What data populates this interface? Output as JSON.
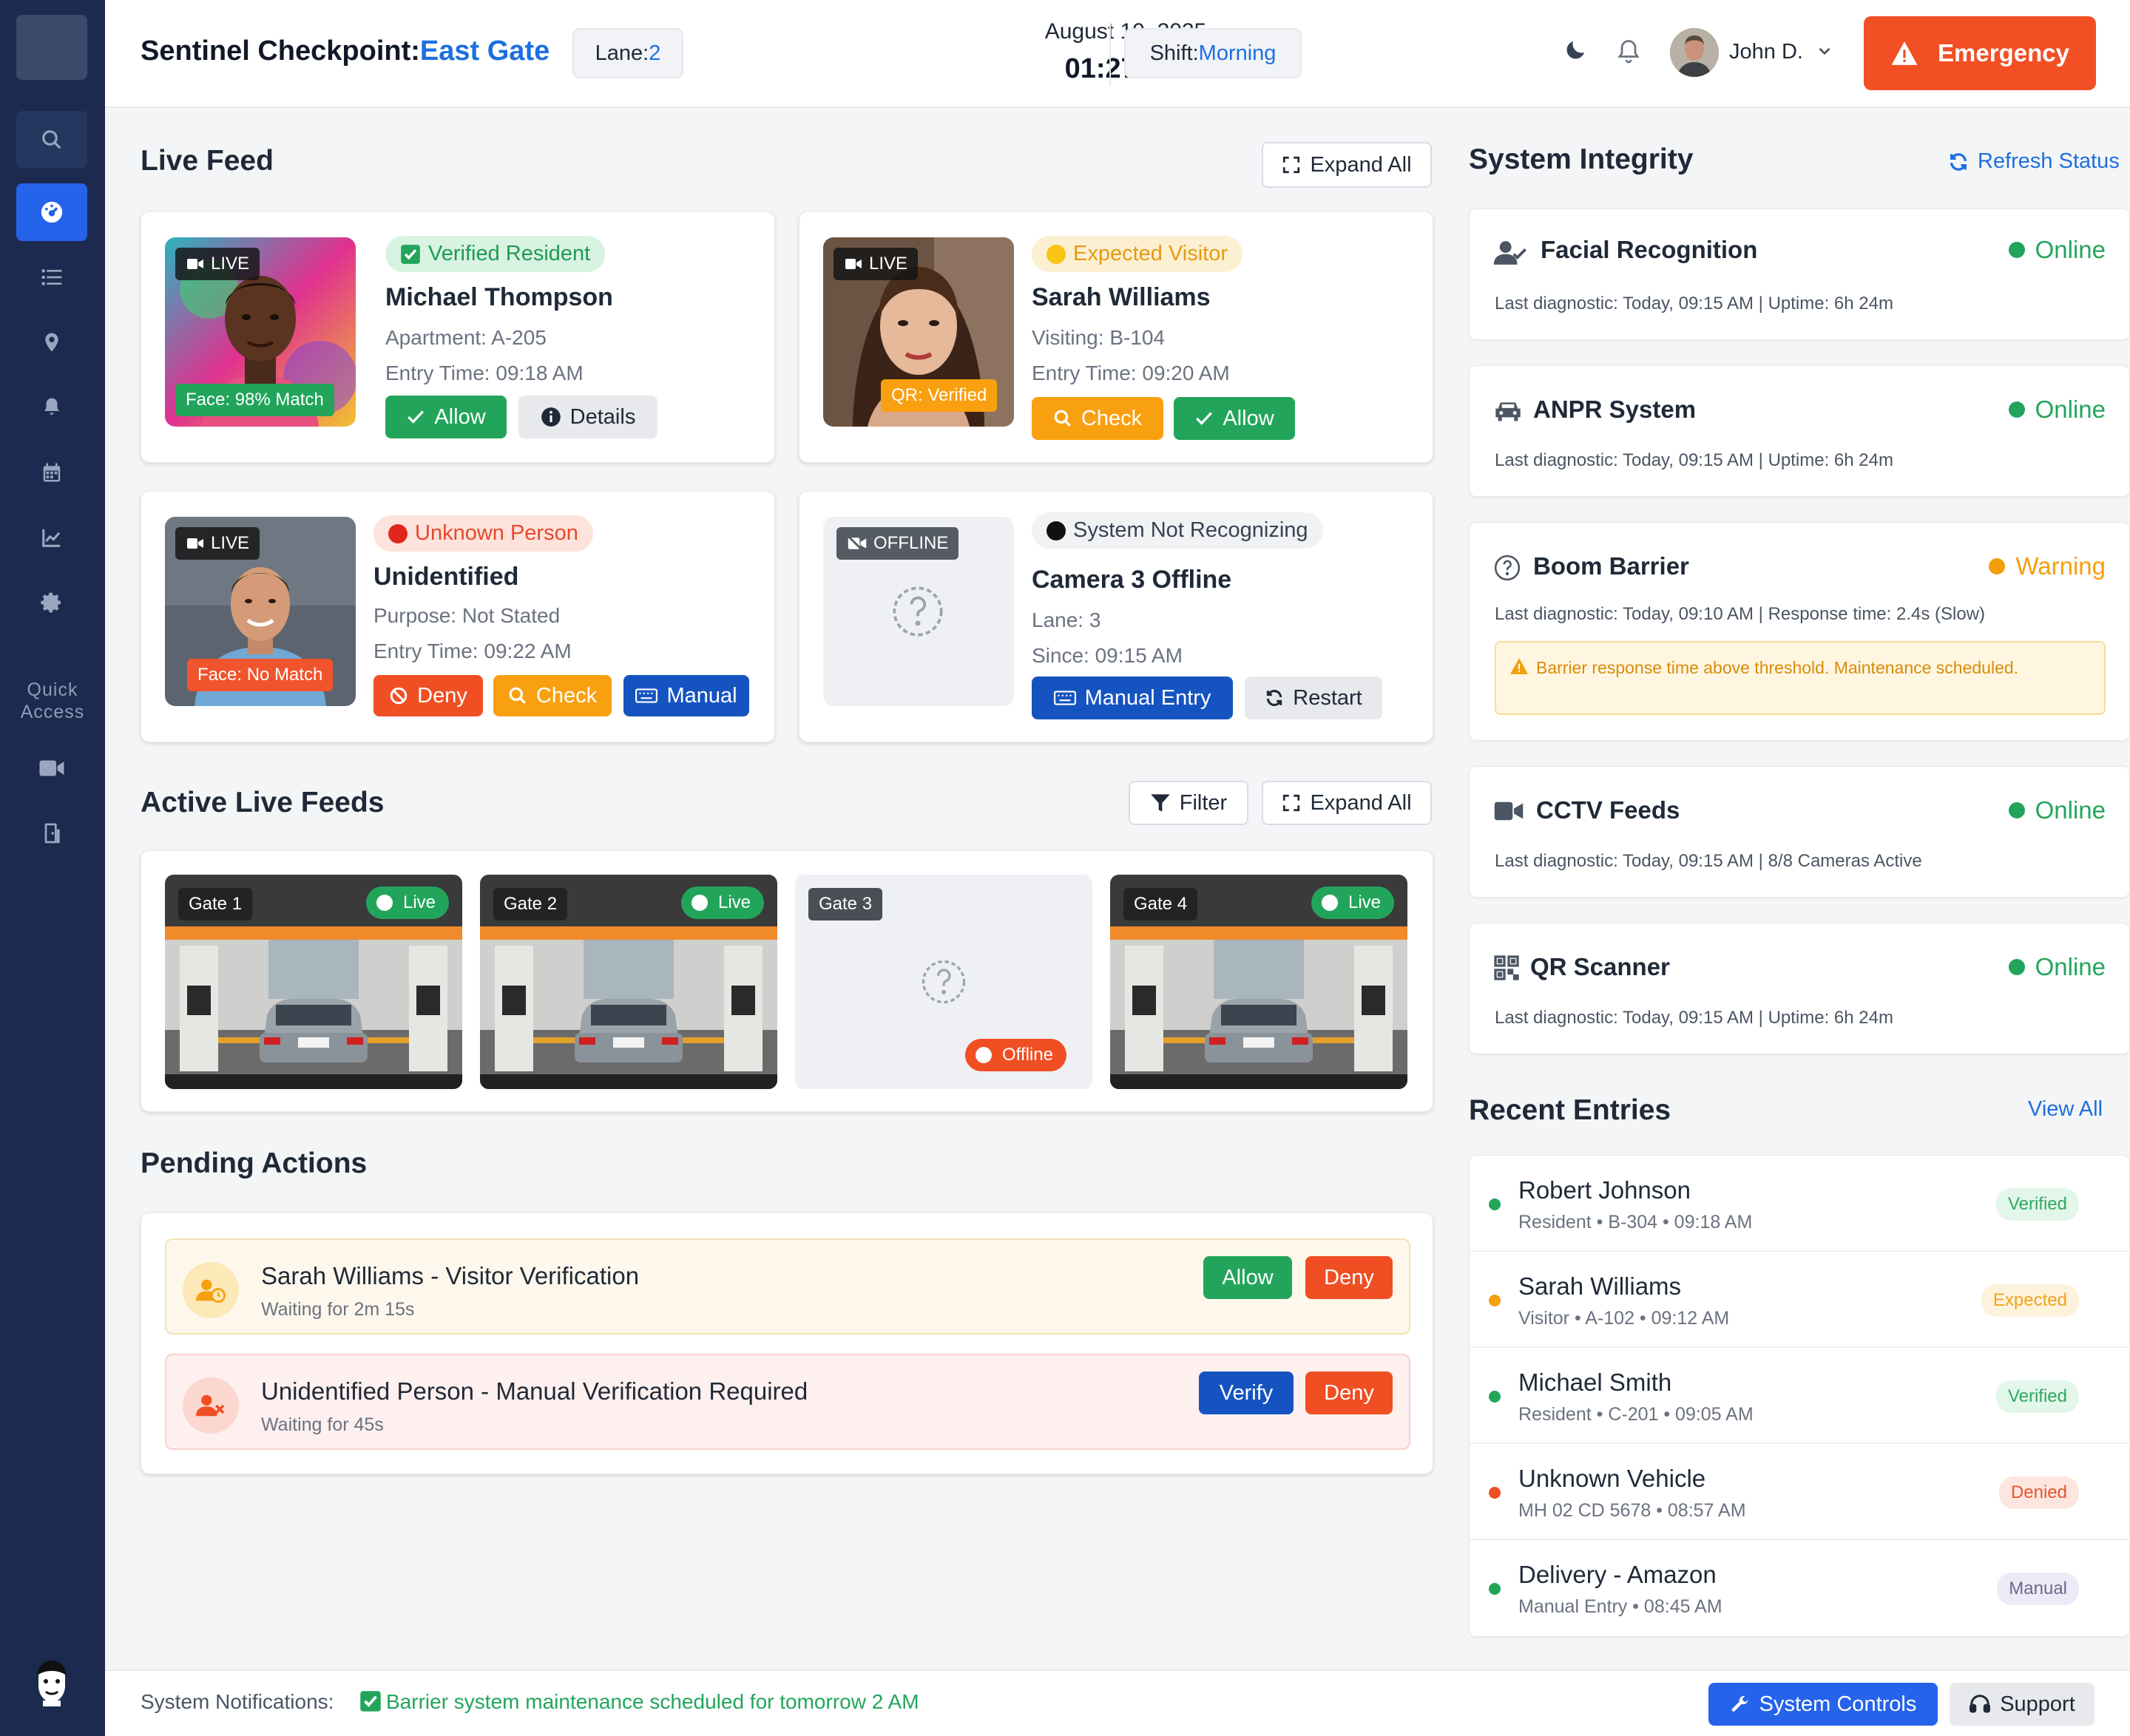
{
  "header": {
    "title_prefix": "Sentinel Checkpoint:",
    "location": "East Gate",
    "lane_label": "Lane:",
    "lane_value": "2",
    "date": "August 10, 2025",
    "time": "01:27 PM",
    "shift_label": "Shift:",
    "shift_value": "Morning",
    "user_name": "John D.",
    "emergency_label": "Emergency"
  },
  "sidebar": {
    "quick_access": "Quick Access",
    "items": [
      "search-icon",
      "dashboard-icon",
      "list-icon",
      "location-icon",
      "bell-icon",
      "calendar-icon",
      "chart-icon",
      "settings-icon"
    ],
    "quick_items": [
      "video-icon",
      "door-icon"
    ]
  },
  "live_feed": {
    "title": "Live Feed",
    "expand_all": "Expand All",
    "cards": [
      {
        "tag": "LIVE",
        "match": "Face: 98% Match",
        "badge": "Verified Resident",
        "name": "Michael Thompson",
        "line1": "Apartment: A-205",
        "line2": "Entry Time: 09:18 AM",
        "actions": [
          "Allow",
          "Details"
        ]
      },
      {
        "tag": "LIVE",
        "match": "QR: Verified",
        "badge": "Expected Visitor",
        "name": "Sarah Williams",
        "line1": "Visiting: B-104",
        "line2": "Entry Time: 09:20 AM",
        "actions": [
          "Check",
          "Allow"
        ]
      },
      {
        "tag": "LIVE",
        "match": "Face: No Match",
        "badge": "Unknown Person",
        "name": "Unidentified",
        "line1": "Purpose: Not Stated",
        "line2": "Entry Time: 09:22 AM",
        "actions": [
          "Deny",
          "Check",
          "Manual"
        ]
      },
      {
        "tag": "OFFLINE",
        "match": "",
        "badge": "System Not Recognizing",
        "name": "Camera 3 Offline",
        "line1": "Lane: 3",
        "line2": "Since: 09:15 AM",
        "actions": [
          "Manual Entry",
          "Restart"
        ]
      }
    ]
  },
  "active_feeds": {
    "title": "Active Live Feeds",
    "filter": "Filter",
    "expand_all": "Expand All",
    "gates": [
      {
        "name": "Gate 1",
        "status": "Live"
      },
      {
        "name": "Gate 2",
        "status": "Live"
      },
      {
        "name": "Gate 3",
        "status": "Offline"
      },
      {
        "name": "Gate 4",
        "status": "Live"
      }
    ]
  },
  "pending": {
    "title": "Pending Actions",
    "items": [
      {
        "title": "Sarah Williams - Visitor Verification",
        "wait": "Waiting for 2m 15s",
        "primary": "Allow",
        "secondary": "Deny"
      },
      {
        "title": "Unidentified Person - Manual Verification Required",
        "wait": "Waiting for 45s",
        "primary": "Verify",
        "secondary": "Deny"
      }
    ]
  },
  "system_integrity": {
    "title": "System Integrity",
    "refresh": "Refresh Status",
    "systems": [
      {
        "name": "Facial Recognition",
        "status": "Online",
        "diag": "Last diagnostic: Today, 09:15 AM | Uptime: 6h 24m"
      },
      {
        "name": "ANPR System",
        "status": "Online",
        "diag": "Last diagnostic: Today, 09:15 AM | Uptime: 6h 24m"
      },
      {
        "name": "Boom Barrier",
        "status": "Warning",
        "diag": "Last diagnostic: Today, 09:10 AM | Response time: 2.4s (Slow)",
        "alert": "Barrier response time above threshold. Maintenance scheduled."
      },
      {
        "name": "CCTV Feeds",
        "status": "Online",
        "diag": "Last diagnostic: Today, 09:15 AM | 8/8 Cameras Active"
      },
      {
        "name": "QR Scanner",
        "status": "Online",
        "diag": "Last diagnostic: Today, 09:15 AM | Uptime: 6h 24m"
      }
    ]
  },
  "recent_entries": {
    "title": "Recent Entries",
    "view_all": "View All",
    "items": [
      {
        "name": "Robert Johnson",
        "sub": "Resident • B-304 • 09:18 AM",
        "badge": "Verified"
      },
      {
        "name": "Sarah Williams",
        "sub": "Visitor • A-102 • 09:12 AM",
        "badge": "Expected"
      },
      {
        "name": "Michael Smith",
        "sub": "Resident • C-201 • 09:05 AM",
        "badge": "Verified"
      },
      {
        "name": "Unknown Vehicle",
        "sub": "MH 02 CD 5678 • 08:57 AM",
        "badge": "Denied"
      },
      {
        "name": "Delivery - Amazon",
        "sub": "Manual Entry • 08:45 AM",
        "badge": "Manual"
      }
    ]
  },
  "footer": {
    "label": "System Notifications:",
    "message": "Barrier system maintenance scheduled for tomorrow 2 AM",
    "system_controls": "System Controls",
    "support": "Support"
  },
  "colors": {
    "primary_blue": "#1d6fe0",
    "success": "#22a55b",
    "warning": "#f9a010",
    "danger": "#f04e23",
    "sidebar": "#1b2a4e"
  }
}
